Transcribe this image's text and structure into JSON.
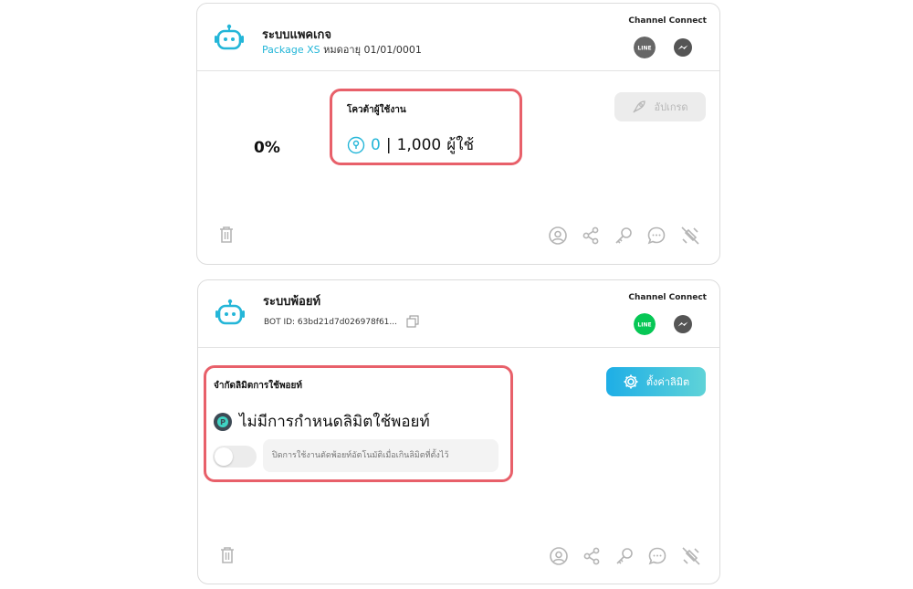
{
  "package_card": {
    "title": "ระบบแพคเกจ",
    "package_prefix": "Package",
    "package_name": "XS",
    "expiry_label": "หมดอายุ",
    "expiry_date": "01/01/0001",
    "channel_label": "Channel Connect",
    "channels": [
      {
        "name": "LINE",
        "connected": false
      },
      {
        "name": "Messenger",
        "connected": false
      }
    ],
    "usage_percent": "0%",
    "quota": {
      "title": "โควต้าผู้ใช้งาน",
      "used": "0",
      "separator": "|",
      "total": "1,000",
      "unit": "ผู้ใช้"
    },
    "upgrade_label": "อัปเกรด",
    "footer_icons": [
      "trash-icon",
      "user-icon",
      "share-icon",
      "key-icon",
      "chat-icon",
      "disconnect-icon"
    ]
  },
  "point_card": {
    "title": "ระบบพ้อยท์",
    "bot_id": "BOT ID: 63bd21d7d026978f61...",
    "channel_label": "Channel Connect",
    "channels": [
      {
        "name": "LINE",
        "connected": true
      },
      {
        "name": "Messenger",
        "connected": false
      }
    ],
    "limit": {
      "title": "จำกัดลิมิตการใช้พอยท์",
      "status": "ไม่มีการกำหนดลิมิตใช้พอยท์",
      "toggle_on": false,
      "input_placeholder": "ปิดการใช้งานตัดพ้อยท์อัตโนมัติเมื่อเกินลิมิตที่ตั้งไว้"
    },
    "set_limit_label": "ตั้งค่าลิมิต"
  },
  "colors": {
    "accent": "#24b6d8",
    "highlight_border": "#e8606a",
    "line_green": "#06c755",
    "icon_grey": "#b5b5b5"
  }
}
